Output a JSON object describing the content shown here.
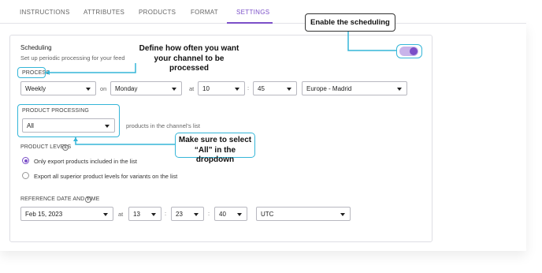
{
  "tabs": [
    {
      "label": "INSTRUCTIONS"
    },
    {
      "label": "ATTRIBUTES"
    },
    {
      "label": "PRODUCTS"
    },
    {
      "label": "FORMAT"
    },
    {
      "label": "SETTINGS",
      "active": true
    }
  ],
  "scheduling": {
    "title": "Scheduling",
    "subtitle": "Set up periodic processing for your feed",
    "enabled": true
  },
  "process": {
    "label": "PROCESS",
    "frequency": "Weekly",
    "on_label": "on",
    "day": "Monday",
    "at_label": "at",
    "hour": "10",
    "colon": ":",
    "minute": "45",
    "timezone": "Europe - Madrid"
  },
  "product_processing": {
    "label": "PRODUCT PROCESSING",
    "value": "All",
    "suffix": "products in the channel's list"
  },
  "product_levels": {
    "label": "PRODUCT LEVELS",
    "help_icon": "?",
    "options": [
      {
        "label": "Only export products included in the list",
        "selected": true
      },
      {
        "label": "Export all superior product levels for variants on the list",
        "selected": false
      }
    ]
  },
  "reference": {
    "label": "REFERENCE DATE AND TIME",
    "help_icon": "?",
    "date": "Feb 15, 2023",
    "at_label": "at",
    "hour": "13",
    "minute": "23",
    "second": "40",
    "colon": ":",
    "timezone": "UTC"
  },
  "annotations": {
    "enable": "Enable the scheduling",
    "define_line1": "Define how often you want",
    "define_line2": "your channel to be",
    "define_line3": "processed",
    "select_line1": "Make sure to select",
    "select_line2": "“All” in the dropdown"
  },
  "colors": {
    "accent": "#7b4fc8",
    "callout": "#35b6d8"
  }
}
